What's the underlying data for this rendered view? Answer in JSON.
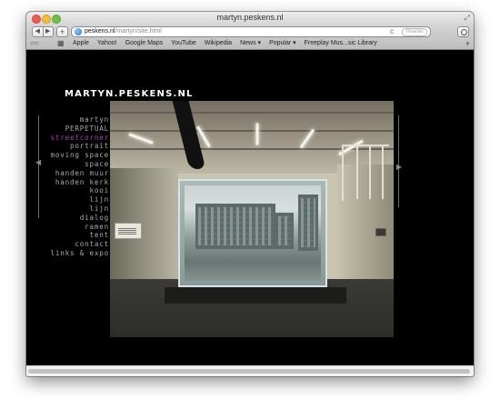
{
  "window": {
    "title": "martyn.peskens.nl"
  },
  "toolbar": {
    "back_icon": "◀",
    "forward_icon": "▶",
    "new_tab_icon": "+",
    "url_host": "peskens.nl",
    "url_path": "/martyn/site.html",
    "reload_icon": "c",
    "reader_label": "Reader"
  },
  "bookmarks": {
    "reading_list_icon": "○○",
    "top_sites_icon": "▦",
    "items": [
      "Apple",
      "Yahoo!",
      "Google Maps",
      "YouTube",
      "Wikipedia",
      "News ▾",
      "Popular ▾",
      "Freeplay Mus...sic Library"
    ],
    "add_icon": "+"
  },
  "site": {
    "title": "MARTYN.PESKENS.NL",
    "prev_arrow": "◀",
    "next_arrow": "▶",
    "menu": [
      {
        "label": "martyn",
        "upper": false,
        "active": false
      },
      {
        "label": "perpetual",
        "upper": true,
        "active": false
      },
      {
        "label": "streetcorner",
        "upper": false,
        "active": true
      },
      {
        "label": "portrait",
        "upper": false,
        "active": false
      },
      {
        "label": "moving space",
        "upper": false,
        "active": false
      },
      {
        "label": "space",
        "upper": false,
        "active": false
      },
      {
        "label": "handen muur",
        "upper": false,
        "active": false
      },
      {
        "label": "handen kerk",
        "upper": false,
        "active": false
      },
      {
        "label": "kooi",
        "upper": false,
        "active": false
      },
      {
        "label": "lijn",
        "upper": false,
        "active": false
      },
      {
        "label": "lijn",
        "upper": false,
        "active": false
      },
      {
        "label": "dialog",
        "upper": false,
        "active": false
      },
      {
        "label": "ramen",
        "upper": false,
        "active": false
      },
      {
        "label": "tent",
        "upper": false,
        "active": false
      },
      {
        "label": "contact",
        "upper": false,
        "active": false
      },
      {
        "label": "links & expo",
        "upper": false,
        "active": false
      }
    ]
  }
}
